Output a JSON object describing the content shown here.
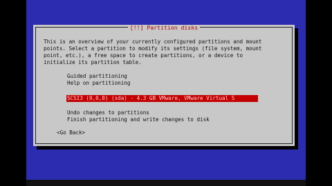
{
  "dialog": {
    "title": "[!!] Partition disks",
    "description_lines": [
      "This is an overview of your currently configured partitions and mount",
      "points. Select a partition to modify its settings (file system, mount",
      "point, etc.), a free space to create partitions, or a device to",
      "initialize its partition table."
    ],
    "menu": {
      "guided": "Guided partitioning",
      "help": "Help on partitioning",
      "disk": "SCSI3 (0,0,0) (sda) - 4.3 GB VMware, VMware Virtual S",
      "undo": "Undo changes to partitions",
      "finish": "Finish partitioning and write changes to disk"
    },
    "go_back": "<Go Back>"
  },
  "colors": {
    "background": "#2c2cb0",
    "dialog": "#c8c8c8",
    "title": "#b00000",
    "selection": "#c40000"
  }
}
